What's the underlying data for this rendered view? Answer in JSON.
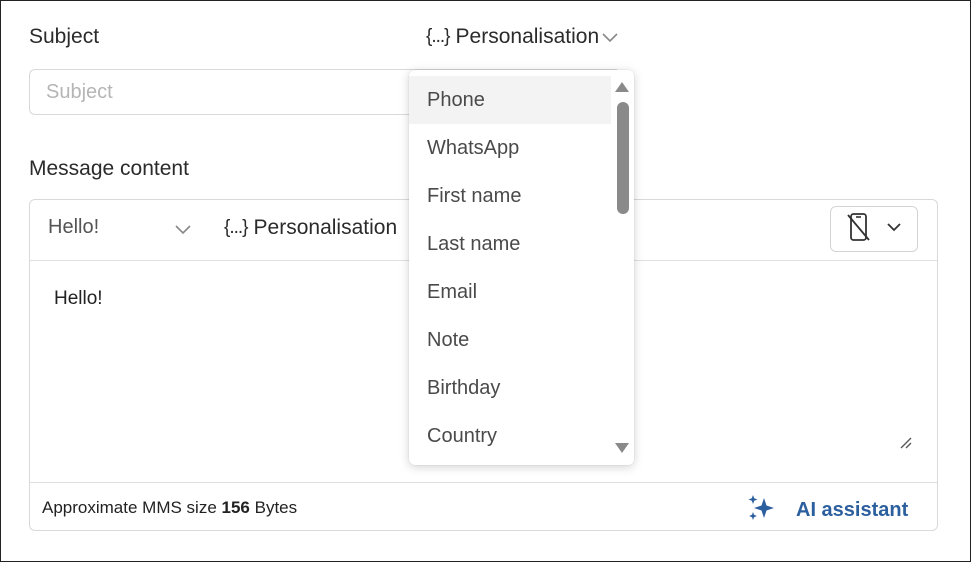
{
  "subject": {
    "label": "Subject",
    "placeholder": "Subject",
    "value": ""
  },
  "personalisation": {
    "braces": "{...}",
    "label": "Personalisation"
  },
  "message": {
    "label": "Message content",
    "template_value": "Hello!",
    "body": "Hello!"
  },
  "footer": {
    "mms_prefix": "Approximate MMS size",
    "mms_size": "156",
    "mms_unit": "Bytes",
    "ai_label": "AI assistant"
  },
  "dropdown": {
    "items": [
      "Phone",
      "WhatsApp",
      "First name",
      "Last name",
      "Email",
      "Note",
      "Birthday",
      "Country"
    ],
    "highlighted": "Phone"
  },
  "colors": {
    "accent": "#2c5f9e",
    "border": "#d9d9d9"
  },
  "icons": {
    "personalise": "chevron-down-icon",
    "device": "no-phone-icon",
    "ai": "sparkles-icon"
  }
}
